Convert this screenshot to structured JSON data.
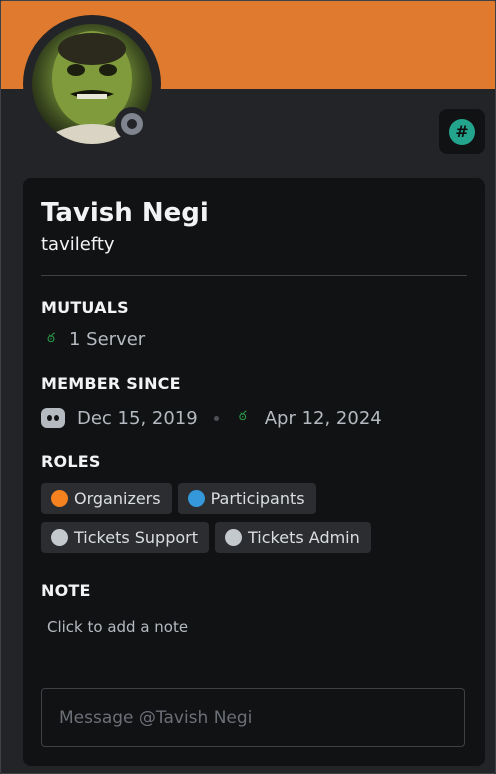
{
  "profile": {
    "display_name": "Tavish Negi",
    "username": "tavilefty",
    "banner_color": "#df7a2f",
    "status": "offline",
    "badge_icon": "hashtag-icon",
    "badge_color": "#23a58d"
  },
  "mutuals": {
    "title": "MUTUALS",
    "servers": "1 Server",
    "icon": "server-icon"
  },
  "member_since": {
    "title": "MEMBER SINCE",
    "discord_date": "Dec 15, 2019",
    "server_date": "Apr 12, 2024"
  },
  "roles": {
    "title": "ROLES",
    "items": [
      {
        "name": "Organizers",
        "color": "#f5811f"
      },
      {
        "name": "Participants",
        "color": "#3498db"
      },
      {
        "name": "Tickets Support",
        "color": "#c4c9ce"
      },
      {
        "name": "Tickets Admin",
        "color": "#c4c9ce"
      }
    ]
  },
  "note": {
    "title": "NOTE",
    "placeholder": "Click to add a note"
  },
  "message": {
    "placeholder": "Message @Tavish Negi"
  }
}
